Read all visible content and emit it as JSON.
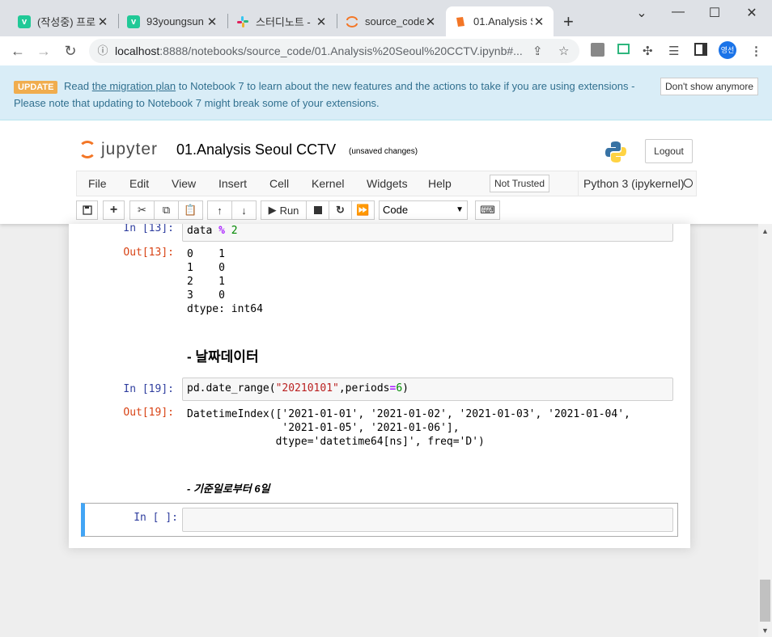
{
  "browser": {
    "tabs": [
      {
        "title": "(작성중) 프로",
        "favicon": "v",
        "color": "#20c997"
      },
      {
        "title": "93youngsun",
        "favicon": "v",
        "color": "#20c997"
      },
      {
        "title": "스터디노트 -",
        "favicon": "slack-icon",
        "color": "#e01e5a"
      },
      {
        "title": "source_code/",
        "favicon": "jupyter-icon",
        "color": "#f37626"
      },
      {
        "title": "01.Analysis S",
        "favicon": "notebook-icon",
        "color": "#f37626"
      }
    ],
    "new_tab": "+",
    "minimize": "⌄",
    "url_host": "localhost",
    "url_path": ":8888/notebooks/source_code/01.Analysis%20Seoul%20CCTV.ipynb#...",
    "profile": "영선"
  },
  "banner": {
    "badge": "UPDATE",
    "read": "Read",
    "link": "the migration plan",
    "text_after_link": "to Notebook 7 to learn about the new features and the actions to take if you are using extensions -",
    "text_line2": "Please note that updating to Notebook 7 might break some of your extensions.",
    "dismiss": "Don't show anymore"
  },
  "jupyter": {
    "logo_text": "jupyter",
    "title": "01.Analysis Seoul CCTV",
    "save_status": "(unsaved changes)",
    "logout": "Logout",
    "menus": [
      "File",
      "Edit",
      "View",
      "Insert",
      "Cell",
      "Kernel",
      "Widgets",
      "Help"
    ],
    "trusted": "Not Trusted",
    "kernel": "Python 3 (ipykernel)",
    "run_label": "Run",
    "cell_type": "Code"
  },
  "cells": {
    "c1": {
      "prompt_in": "In [13]:",
      "code_a": "data ",
      "code_op": "%",
      "code_num": "2",
      "prompt_out": "Out[13]:",
      "output": "0    1\n1    0\n2    1\n3    0\ndtype: int64"
    },
    "md1": "- 날짜데이터",
    "c2": {
      "prompt_in": "In [19]:",
      "code_a": "pd.date_range(",
      "code_str": "\"20210101\"",
      "code_b": ",periods",
      "code_eq": "=",
      "code_num": "6",
      "code_c": ")",
      "prompt_out": "Out[19]:",
      "output": "DatetimeIndex(['2021-01-01', '2021-01-02', '2021-01-03', '2021-01-04',\n               '2021-01-05', '2021-01-06'],\n              dtype='datetime64[ns]', freq='D')"
    },
    "md2": "- 기준일로부터 6일",
    "c3": {
      "prompt_in": "In [ ]:"
    }
  }
}
